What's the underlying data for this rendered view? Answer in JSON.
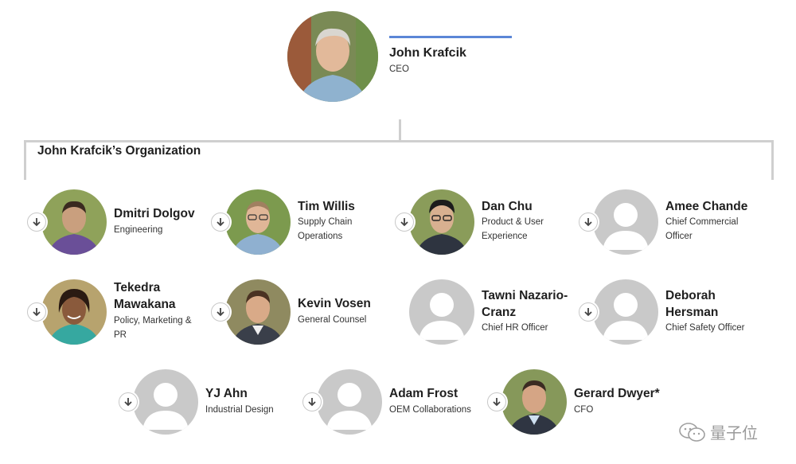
{
  "ceo": {
    "name": "John Krafcik",
    "title": "CEO"
  },
  "org_title": "John Krafcik’s Organization",
  "people": {
    "dolgov": {
      "name": "Dmitri Dolgov",
      "title": "Engineering"
    },
    "willis": {
      "name": "Tim Willis",
      "title_1": "Supply Chain",
      "title_2": "Operations"
    },
    "chu": {
      "name": "Dan Chu",
      "title_1": "Product & User",
      "title_2": "Experience"
    },
    "chande": {
      "name": "Amee Chande",
      "title_1": "Chief Commercial",
      "title_2": "Officer"
    },
    "mawakana": {
      "name_1": "Tekedra",
      "name_2": "Mawakana",
      "title_1": "Policy, Marketing &",
      "title_2": "PR"
    },
    "vosen": {
      "name": "Kevin Vosen",
      "title": "General Counsel"
    },
    "nazario": {
      "name_1": "Tawni Nazario-",
      "name_2": "Cranz",
      "title": "Chief HR Officer"
    },
    "hersman": {
      "name_1": "Deborah",
      "name_2": "Hersman",
      "title": "Chief Safety Officer"
    },
    "ahn": {
      "name": "YJ Ahn",
      "title": "Industrial Design"
    },
    "frost": {
      "name": "Adam Frost",
      "title": "OEM Collaborations"
    },
    "dwyer": {
      "name": "Gerard Dwyer*",
      "title": "CFO"
    }
  },
  "watermark": {
    "text": "量子位",
    "icon": "wechat-icon"
  },
  "colors": {
    "accent": "#5b86d6",
    "placeholder_bg": "#c9c9c9",
    "placeholder_fg": "#ffffff",
    "connector": "#cfcfcf"
  }
}
